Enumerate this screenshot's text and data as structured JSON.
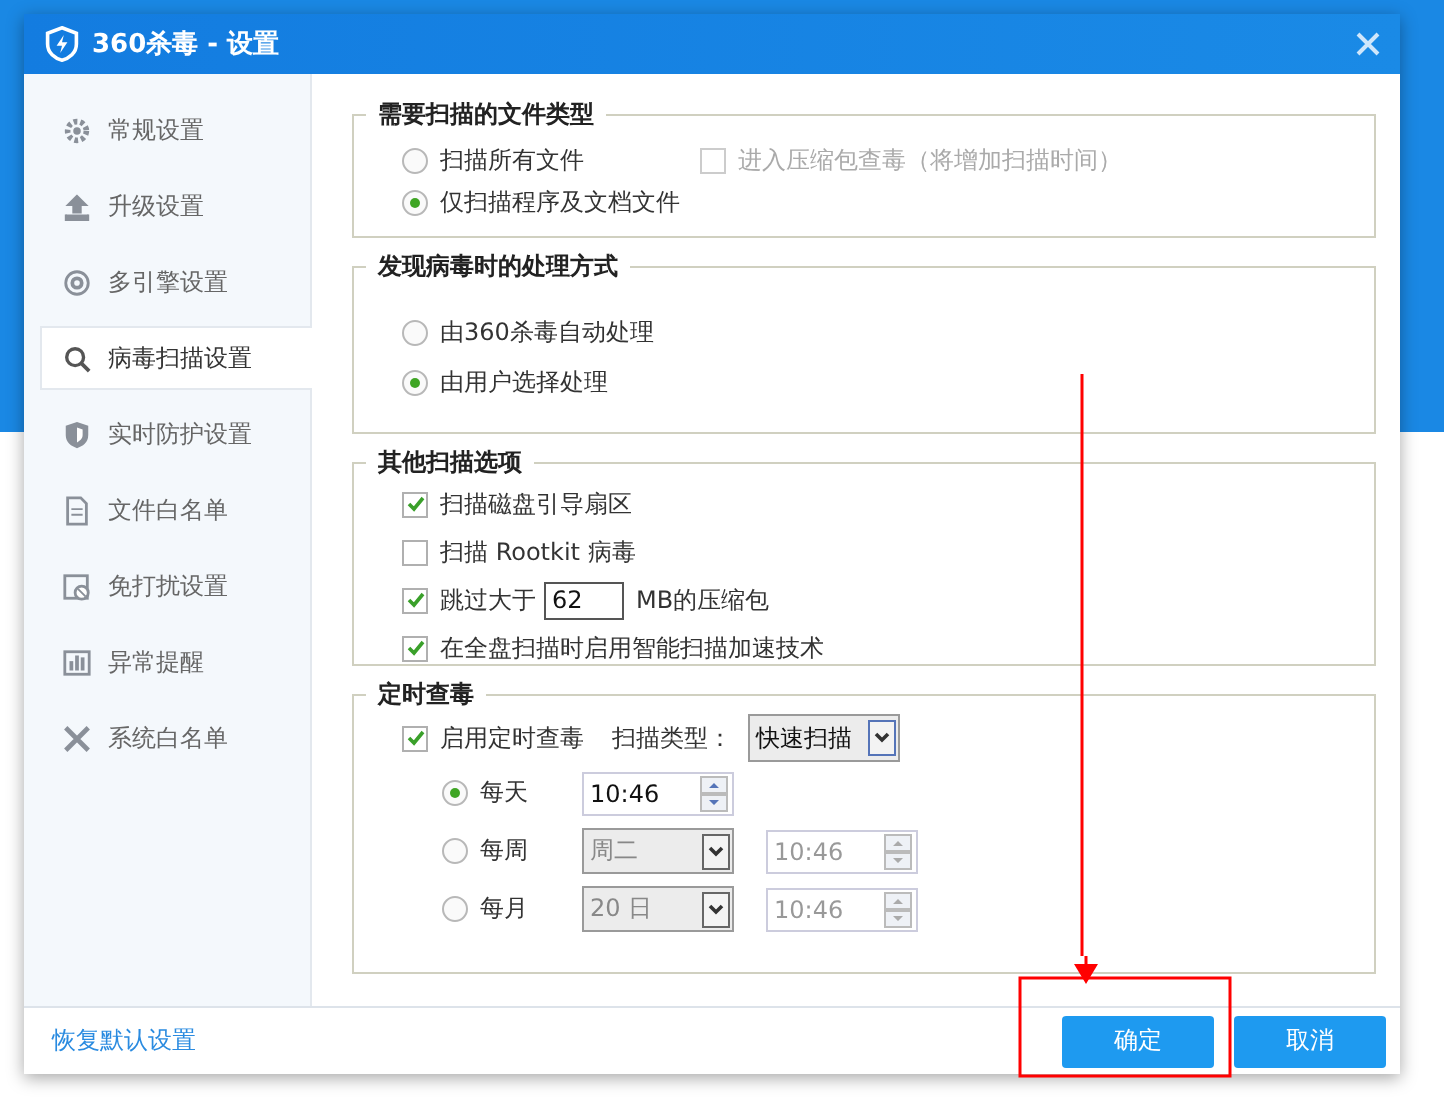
{
  "window": {
    "title": "360杀毒 - 设置"
  },
  "sidebar": {
    "items": [
      {
        "label": "常规设置",
        "selected": false
      },
      {
        "label": "升级设置",
        "selected": false
      },
      {
        "label": "多引擎设置",
        "selected": false
      },
      {
        "label": "病毒扫描设置",
        "selected": true
      },
      {
        "label": "实时防护设置",
        "selected": false
      },
      {
        "label": "文件白名单",
        "selected": false
      },
      {
        "label": "免打扰设置",
        "selected": false
      },
      {
        "label": "异常提醒",
        "selected": false
      },
      {
        "label": "系统白名单",
        "selected": false
      }
    ]
  },
  "file_types": {
    "title": "需要扫描的文件类型",
    "options": [
      {
        "label": "扫描所有文件",
        "selected": false
      },
      {
        "label": "仅扫描程序及文档文件",
        "selected": true
      }
    ],
    "archive_option": {
      "label": "进入压缩包查毒（将增加扫描时间）",
      "checked": false,
      "disabled": true
    }
  },
  "virus_handling": {
    "title": "发现病毒时的处理方式",
    "options": [
      {
        "label": "由360杀毒自动处理",
        "selected": false
      },
      {
        "label": "由用户选择处理",
        "selected": true
      }
    ]
  },
  "other_options": {
    "title": "其他扫描选项",
    "items": [
      {
        "kind": "checkbox",
        "label": "扫描磁盘引导扇区",
        "checked": true
      },
      {
        "kind": "checkbox",
        "label": "扫描 Rootkit 病毒",
        "checked": false
      },
      {
        "kind": "size",
        "label": "跳过大于",
        "value": "62",
        "unit": "MB的压缩包",
        "checked": true
      },
      {
        "kind": "checkbox",
        "label": "在全盘扫描时启用智能扫描加速技术",
        "checked": true
      }
    ]
  },
  "schedule": {
    "title": "定时查毒",
    "enabled": {
      "label": "启用定时查毒",
      "checked": true
    },
    "scan_type_label": "扫描类型：",
    "scan_type_value": "快速扫描",
    "rows": [
      {
        "label": "每天",
        "selected": true,
        "time": "10:46"
      },
      {
        "label": "每周",
        "selected": false,
        "day": "周二",
        "time": "10:46"
      },
      {
        "label": "每月",
        "selected": false,
        "day": "20 日",
        "time": "10:46"
      }
    ]
  },
  "footer": {
    "restore_link": "恢复默认设置",
    "buttons": [
      {
        "label": "确定"
      },
      {
        "label": "取消"
      }
    ]
  }
}
